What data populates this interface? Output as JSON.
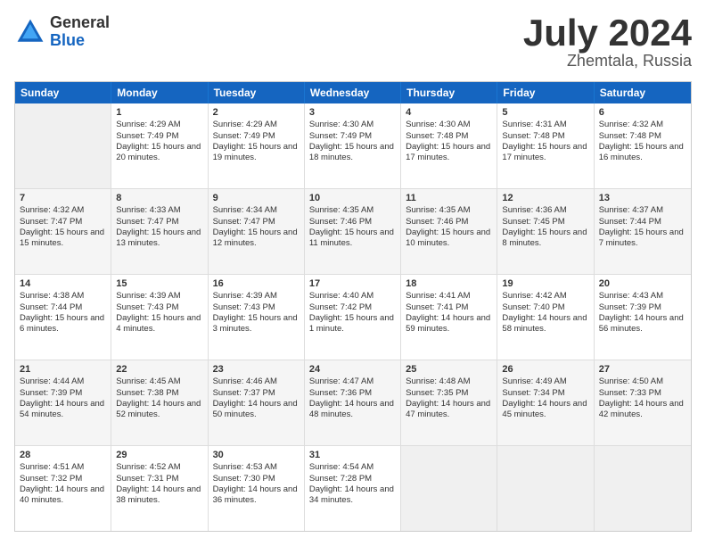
{
  "logo": {
    "general": "General",
    "blue": "Blue"
  },
  "title": "July 2024",
  "subtitle": "Zhemtala, Russia",
  "header_days": [
    "Sunday",
    "Monday",
    "Tuesday",
    "Wednesday",
    "Thursday",
    "Friday",
    "Saturday"
  ],
  "weeks": [
    [
      {
        "day": "",
        "empty": true
      },
      {
        "day": "1",
        "sunrise": "Sunrise: 4:29 AM",
        "sunset": "Sunset: 7:49 PM",
        "daylight": "Daylight: 15 hours and 20 minutes."
      },
      {
        "day": "2",
        "sunrise": "Sunrise: 4:29 AM",
        "sunset": "Sunset: 7:49 PM",
        "daylight": "Daylight: 15 hours and 19 minutes."
      },
      {
        "day": "3",
        "sunrise": "Sunrise: 4:30 AM",
        "sunset": "Sunset: 7:49 PM",
        "daylight": "Daylight: 15 hours and 18 minutes."
      },
      {
        "day": "4",
        "sunrise": "Sunrise: 4:30 AM",
        "sunset": "Sunset: 7:48 PM",
        "daylight": "Daylight: 15 hours and 17 minutes."
      },
      {
        "day": "5",
        "sunrise": "Sunrise: 4:31 AM",
        "sunset": "Sunset: 7:48 PM",
        "daylight": "Daylight: 15 hours and 17 minutes."
      },
      {
        "day": "6",
        "sunrise": "Sunrise: 4:32 AM",
        "sunset": "Sunset: 7:48 PM",
        "daylight": "Daylight: 15 hours and 16 minutes."
      }
    ],
    [
      {
        "day": "7",
        "sunrise": "Sunrise: 4:32 AM",
        "sunset": "Sunset: 7:47 PM",
        "daylight": "Daylight: 15 hours and 15 minutes."
      },
      {
        "day": "8",
        "sunrise": "Sunrise: 4:33 AM",
        "sunset": "Sunset: 7:47 PM",
        "daylight": "Daylight: 15 hours and 13 minutes."
      },
      {
        "day": "9",
        "sunrise": "Sunrise: 4:34 AM",
        "sunset": "Sunset: 7:47 PM",
        "daylight": "Daylight: 15 hours and 12 minutes."
      },
      {
        "day": "10",
        "sunrise": "Sunrise: 4:35 AM",
        "sunset": "Sunset: 7:46 PM",
        "daylight": "Daylight: 15 hours and 11 minutes."
      },
      {
        "day": "11",
        "sunrise": "Sunrise: 4:35 AM",
        "sunset": "Sunset: 7:46 PM",
        "daylight": "Daylight: 15 hours and 10 minutes."
      },
      {
        "day": "12",
        "sunrise": "Sunrise: 4:36 AM",
        "sunset": "Sunset: 7:45 PM",
        "daylight": "Daylight: 15 hours and 8 minutes."
      },
      {
        "day": "13",
        "sunrise": "Sunrise: 4:37 AM",
        "sunset": "Sunset: 7:44 PM",
        "daylight": "Daylight: 15 hours and 7 minutes."
      }
    ],
    [
      {
        "day": "14",
        "sunrise": "Sunrise: 4:38 AM",
        "sunset": "Sunset: 7:44 PM",
        "daylight": "Daylight: 15 hours and 6 minutes."
      },
      {
        "day": "15",
        "sunrise": "Sunrise: 4:39 AM",
        "sunset": "Sunset: 7:43 PM",
        "daylight": "Daylight: 15 hours and 4 minutes."
      },
      {
        "day": "16",
        "sunrise": "Sunrise: 4:39 AM",
        "sunset": "Sunset: 7:43 PM",
        "daylight": "Daylight: 15 hours and 3 minutes."
      },
      {
        "day": "17",
        "sunrise": "Sunrise: 4:40 AM",
        "sunset": "Sunset: 7:42 PM",
        "daylight": "Daylight: 15 hours and 1 minute."
      },
      {
        "day": "18",
        "sunrise": "Sunrise: 4:41 AM",
        "sunset": "Sunset: 7:41 PM",
        "daylight": "Daylight: 14 hours and 59 minutes."
      },
      {
        "day": "19",
        "sunrise": "Sunrise: 4:42 AM",
        "sunset": "Sunset: 7:40 PM",
        "daylight": "Daylight: 14 hours and 58 minutes."
      },
      {
        "day": "20",
        "sunrise": "Sunrise: 4:43 AM",
        "sunset": "Sunset: 7:39 PM",
        "daylight": "Daylight: 14 hours and 56 minutes."
      }
    ],
    [
      {
        "day": "21",
        "sunrise": "Sunrise: 4:44 AM",
        "sunset": "Sunset: 7:39 PM",
        "daylight": "Daylight: 14 hours and 54 minutes."
      },
      {
        "day": "22",
        "sunrise": "Sunrise: 4:45 AM",
        "sunset": "Sunset: 7:38 PM",
        "daylight": "Daylight: 14 hours and 52 minutes."
      },
      {
        "day": "23",
        "sunrise": "Sunrise: 4:46 AM",
        "sunset": "Sunset: 7:37 PM",
        "daylight": "Daylight: 14 hours and 50 minutes."
      },
      {
        "day": "24",
        "sunrise": "Sunrise: 4:47 AM",
        "sunset": "Sunset: 7:36 PM",
        "daylight": "Daylight: 14 hours and 48 minutes."
      },
      {
        "day": "25",
        "sunrise": "Sunrise: 4:48 AM",
        "sunset": "Sunset: 7:35 PM",
        "daylight": "Daylight: 14 hours and 47 minutes."
      },
      {
        "day": "26",
        "sunrise": "Sunrise: 4:49 AM",
        "sunset": "Sunset: 7:34 PM",
        "daylight": "Daylight: 14 hours and 45 minutes."
      },
      {
        "day": "27",
        "sunrise": "Sunrise: 4:50 AM",
        "sunset": "Sunset: 7:33 PM",
        "daylight": "Daylight: 14 hours and 42 minutes."
      }
    ],
    [
      {
        "day": "28",
        "sunrise": "Sunrise: 4:51 AM",
        "sunset": "Sunset: 7:32 PM",
        "daylight": "Daylight: 14 hours and 40 minutes."
      },
      {
        "day": "29",
        "sunrise": "Sunrise: 4:52 AM",
        "sunset": "Sunset: 7:31 PM",
        "daylight": "Daylight: 14 hours and 38 minutes."
      },
      {
        "day": "30",
        "sunrise": "Sunrise: 4:53 AM",
        "sunset": "Sunset: 7:30 PM",
        "daylight": "Daylight: 14 hours and 36 minutes."
      },
      {
        "day": "31",
        "sunrise": "Sunrise: 4:54 AM",
        "sunset": "Sunset: 7:28 PM",
        "daylight": "Daylight: 14 hours and 34 minutes."
      },
      {
        "day": "",
        "empty": true
      },
      {
        "day": "",
        "empty": true
      },
      {
        "day": "",
        "empty": true
      }
    ]
  ]
}
